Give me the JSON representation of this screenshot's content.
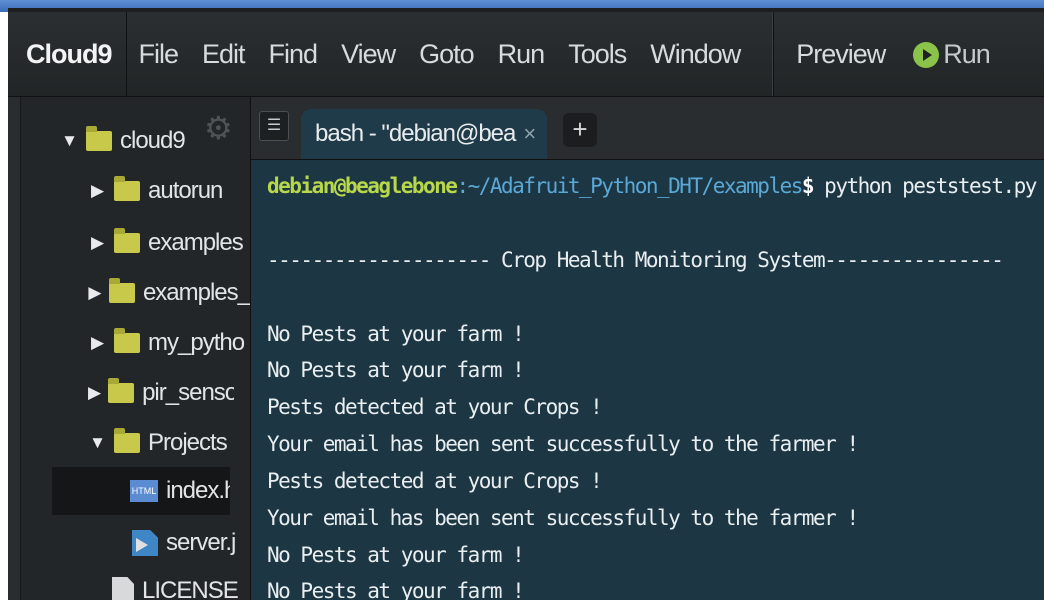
{
  "menubar": {
    "brand": "Cloud9",
    "items": [
      "File",
      "Edit",
      "Find",
      "View",
      "Goto",
      "Run",
      "Tools",
      "Window"
    ],
    "preview": "Preview",
    "run": "Run"
  },
  "sidebar": {
    "items": [
      {
        "label": "cloud9",
        "kind": "folder",
        "expanded": true
      },
      {
        "label": "autorun",
        "kind": "folder",
        "expanded": false
      },
      {
        "label": "examples",
        "kind": "folder",
        "expanded": false
      },
      {
        "label": "examples_",
        "kind": "folder",
        "expanded": false
      },
      {
        "label": "my_pytho",
        "kind": "folder",
        "expanded": false
      },
      {
        "label": "pir_sensor",
        "kind": "folder",
        "expanded": false
      },
      {
        "label": "Projects",
        "kind": "folder",
        "expanded": true
      },
      {
        "label": "index.h",
        "kind": "html-file"
      },
      {
        "label": "server.j",
        "kind": "js-file"
      },
      {
        "label": "LICENSE",
        "kind": "file"
      }
    ],
    "html_badge": "HTML"
  },
  "tabs": {
    "active": "bash - \"debian@bea",
    "close": "×",
    "add": "+"
  },
  "terminal": {
    "prompt_user": "debian@beaglebone",
    "prompt_path": ":~/Adafruit_Python_DHT/examples",
    "prompt_dollar": "$",
    "command": " python peststest.py",
    "lines": [
      "-------------------- Crop Health Monitoring System----------------",
      "No Pests at your farm !",
      "No Pests at your farm !",
      "Pests detected at your Crops !",
      "Your email has been sent successfully to the farmer !",
      "Pests detected at your Crops !",
      "Your email has been sent successfully to the farmer !",
      "No Pests at your farm !",
      "No Pests at your farm !"
    ]
  },
  "colors": {
    "terminal_bg": "#1c3644",
    "prompt_user": "#b8d84a",
    "prompt_path": "#5aa9d6",
    "folder": "#c8c94a"
  }
}
